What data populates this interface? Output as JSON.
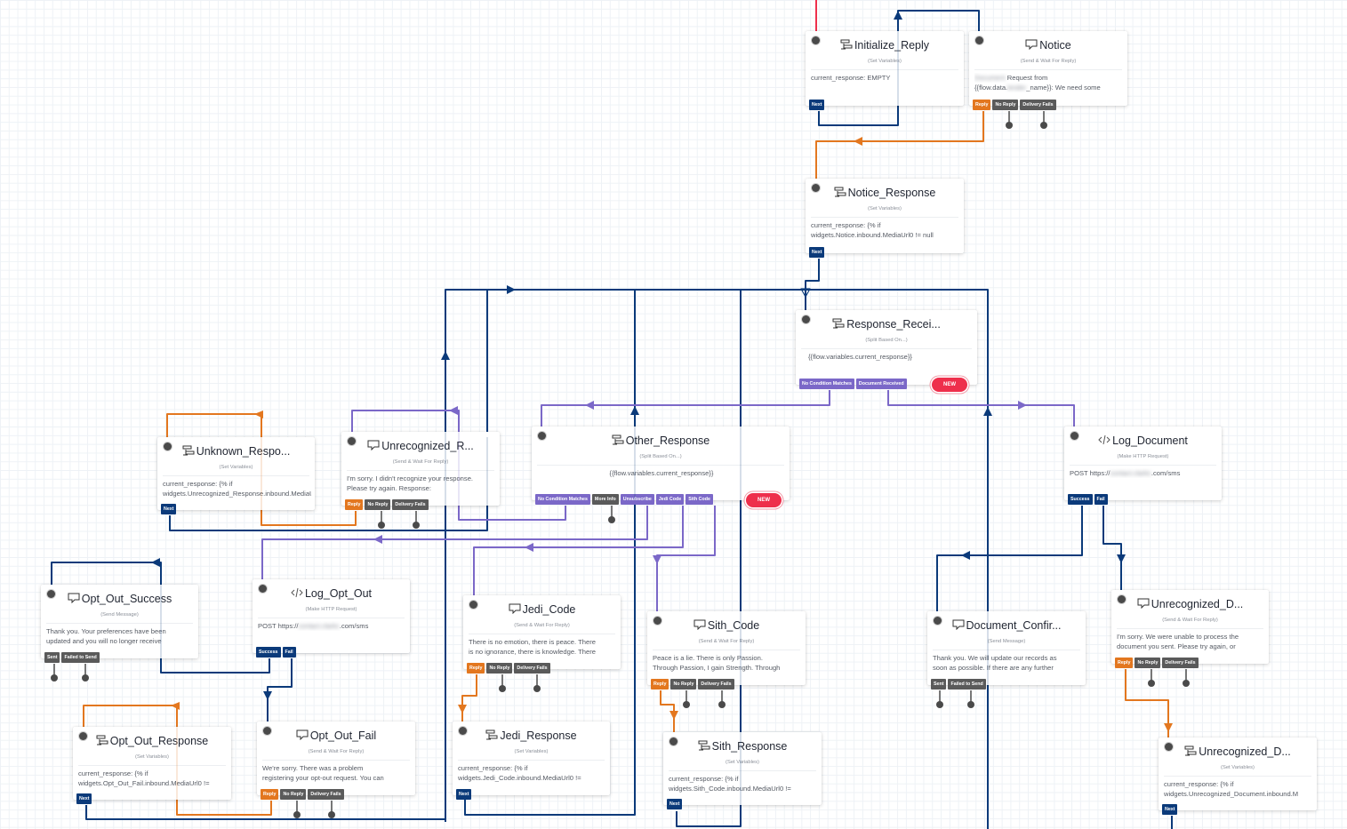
{
  "canvas": {
    "colors": {
      "next": "#0b3a7a",
      "reply": "#e3771f",
      "noreply": "#5a5a5a",
      "split": "#7b68c8",
      "new": "#ee2f4c",
      "trigger": "#ee2f4c"
    }
  },
  "widgets": {
    "initialize_reply": {
      "icon": "set-variables-icon",
      "title": "Initialize_Reply",
      "type": "(Set Variables)",
      "lines": [
        "current_response: EMPTY"
      ],
      "ports": [
        "Next"
      ]
    },
    "notice": {
      "icon": "message-icon",
      "title": "Notice",
      "type": "(Send & Wait For Reply)",
      "line1_redacted": "Document",
      "line1": "Request from",
      "line2_a": "{{flow.data.",
      "line2_redacted": "lender",
      "line2_b": "_name}}: We need some",
      "ports": [
        "Reply",
        "No Reply",
        "Delivery Fails"
      ]
    },
    "notice_response": {
      "icon": "set-variables-icon",
      "title": "Notice_Response",
      "type": "(Set Variables)",
      "lines": [
        "current_response: {% if",
        "widgets.Notice.inbound.MediaUrl0 != null"
      ],
      "ports": [
        "Next"
      ]
    },
    "response_received": {
      "icon": "split-icon",
      "title": "Response_Recei...",
      "type": "(Split Based On...)",
      "lines": [
        "{{flow.variables.current_response}}"
      ],
      "ports": [
        "No Condition Matches",
        "Document Received"
      ],
      "new_label": "NEW"
    },
    "unknown_response": {
      "icon": "set-variables-icon",
      "title": "Unknown_Respo...",
      "type": "(Set Variables)",
      "lines": [
        "current_response: {% if",
        "widgets.Unrecognized_Response.inbound.MediaUrl0"
      ],
      "ports": [
        "Next"
      ]
    },
    "unrecognized_response": {
      "icon": "message-icon",
      "title": "Unrecognized_R...",
      "type": "(Send & Wait For Reply)",
      "lines": [
        "I'm sorry. I didn't recognize your response.",
        "Please try again. Response:"
      ],
      "ports": [
        "Reply",
        "No Reply",
        "Delivery Fails"
      ]
    },
    "other_response": {
      "icon": "split-icon",
      "title": "Other_Response",
      "type": "(Split Based On...)",
      "lines": [
        "{{flow.variables.current_response}}"
      ],
      "ports": [
        "No Condition Matches",
        "More Info",
        "Unsubscribe",
        "Jedi Code",
        "Sith Code"
      ],
      "new_label": "NEW"
    },
    "log_document": {
      "icon": "http-icon",
      "title": "Log_Document",
      "type": "(Make HTTP Request)",
      "line_a": "POST https://",
      "line_redacted": "contact.clarkc",
      "line_b": ".com/sms",
      "ports": [
        "Success",
        "Fail"
      ]
    },
    "opt_out_success": {
      "icon": "message-icon",
      "title": "Opt_Out_Success",
      "type": "(Send Message)",
      "lines": [
        "Thank you. Your preferences have been",
        "updated and you will no longer receive"
      ],
      "ports": [
        "Sent",
        "Failed to Send"
      ]
    },
    "log_opt_out": {
      "icon": "http-icon",
      "title": "Log_Opt_Out",
      "type": "(Make HTTP Request)",
      "line_a": "POST https://",
      "line_redacted": "contact.clarkc",
      "line_b": ".com/sms",
      "ports": [
        "Success",
        "Fail"
      ]
    },
    "jedi_code": {
      "icon": "message-icon",
      "title": "Jedi_Code",
      "type": "(Send & Wait For Reply)",
      "lines": [
        "There is no emotion, there is peace. There",
        "is no ignorance, there is knowledge. There"
      ],
      "ports": [
        "Reply",
        "No Reply",
        "Delivery Fails"
      ]
    },
    "sith_code": {
      "icon": "message-icon",
      "title": "Sith_Code",
      "type": "(Send & Wait For Reply)",
      "lines": [
        "Peace is a lie. There is only Passion.",
        "Through Passion, I gain Strength. Through"
      ],
      "ports": [
        "Reply",
        "No Reply",
        "Delivery Fails"
      ]
    },
    "document_confirmation": {
      "icon": "message-icon",
      "title": "Document_Confir...",
      "type": "(Send Message)",
      "lines": [
        "Thank you. We will update our records as",
        "soon as possible. If there are any further"
      ],
      "ports": [
        "Sent",
        "Failed to Send"
      ]
    },
    "unrecognized_document": {
      "icon": "message-icon",
      "title": "Unrecognized_D...",
      "type": "(Send & Wait For Reply)",
      "lines": [
        "I'm sorry. We were unable to process the",
        "document you sent. Please try again, or"
      ],
      "ports": [
        "Reply",
        "No Reply",
        "Delivery Fails"
      ]
    },
    "opt_out_response": {
      "icon": "set-variables-icon",
      "title": "Opt_Out_Response",
      "type": "(Set Variables)",
      "lines": [
        "current_response: {% if",
        "widgets.Opt_Out_Fail.inbound.MediaUrl0 !="
      ],
      "ports": [
        "Next"
      ]
    },
    "opt_out_fail": {
      "icon": "message-icon",
      "title": "Opt_Out_Fail",
      "type": "(Send & Wait For Reply)",
      "lines": [
        "We're sorry. There was a problem",
        "registering your opt-out request. You can"
      ],
      "ports": [
        "Reply",
        "No Reply",
        "Delivery Fails"
      ]
    },
    "jedi_response": {
      "icon": "set-variables-icon",
      "title": "Jedi_Response",
      "type": "(Set Variables)",
      "lines": [
        "current_response: {% if",
        "widgets.Jedi_Code.inbound.MediaUrl0 !="
      ],
      "ports": [
        "Next"
      ]
    },
    "sith_response": {
      "icon": "set-variables-icon",
      "title": "Sith_Response",
      "type": "(Set Variables)",
      "lines": [
        "current_response: {% if",
        "widgets.Sith_Code.inbound.MediaUrl0 !="
      ],
      "ports": [
        "Next"
      ]
    },
    "unrecognized_document_vars": {
      "icon": "set-variables-icon",
      "title": "Unrecognized_D...",
      "type": "(Set Variables)",
      "lines": [
        "current_response: {% if",
        "widgets.Unrecognized_Document.inbound.M"
      ],
      "ports": [
        "Next"
      ]
    }
  }
}
